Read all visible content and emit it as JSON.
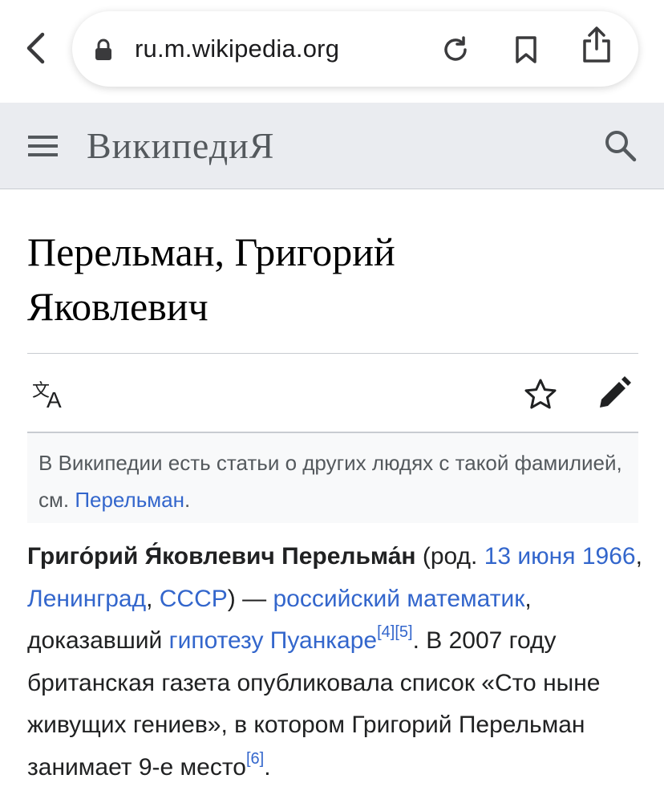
{
  "browser": {
    "url": "ru.m.wikipedia.org"
  },
  "header": {
    "logo": "ВикипедиЯ"
  },
  "page": {
    "title_line1": "Перельман, Григорий",
    "title_line2": "Яковлевич"
  },
  "hatnote": {
    "text_before": "В Википедии есть статьи о других людях с такой фамилией, см. ",
    "link": "Перельман",
    "text_after": "."
  },
  "lead": {
    "name": "Григо́рий Я́ковлевич Перельма́н",
    "t1": " (род. ",
    "birth_date_link": "13 июня 1966",
    "t2": ", ",
    "birthplace_link": "Ленинград",
    "t3": ", ",
    "country_link": "СССР",
    "t4": ") — ",
    "occupation_link": "российский математик",
    "t5": ", доказавший ",
    "conjecture_link": "гипотезу Пуанкаре",
    "ref4": "[4]",
    "ref5": "[5]",
    "t6": ". В 2007 году британская газета опубликовала список «Сто ныне живущих гениев», в котором Григорий Перельман занимает 9-е место",
    "ref6": "[6]",
    "t7": "."
  },
  "colors": {
    "link": "#3366cc",
    "header_bg": "#eaecf0",
    "hatnote_bg": "#f8f9fa"
  },
  "icons": [
    "back-chevron-icon",
    "lock-icon",
    "reload-icon",
    "bookmark-icon",
    "share-icon",
    "menu-icon",
    "search-icon",
    "language-icon",
    "star-icon",
    "edit-pencil-icon"
  ]
}
